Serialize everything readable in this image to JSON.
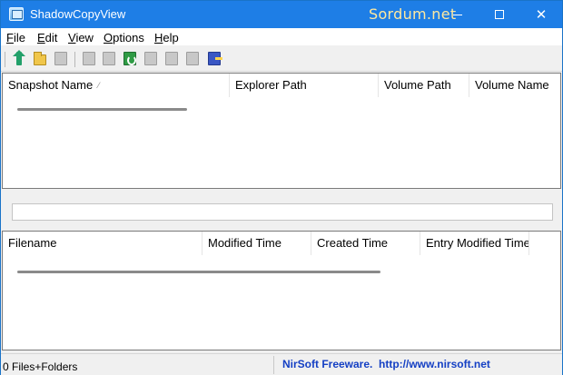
{
  "window": {
    "title": "ShadowCopyView",
    "watermark": "Sordum.net",
    "minimize_glyph": "",
    "maximize_glyph": "",
    "close_glyph": "✕"
  },
  "menu": [
    {
      "label": "File",
      "accel": "F",
      "rest": "ile"
    },
    {
      "label": "Edit",
      "accel": "E",
      "rest": "dit"
    },
    {
      "label": "View",
      "accel": "V",
      "rest": "iew"
    },
    {
      "label": "Options",
      "accel": "O",
      "rest": "ptions"
    },
    {
      "label": "Help",
      "accel": "H",
      "rest": "elp"
    }
  ],
  "toolbar": [
    {
      "icon": "up-arrow-icon",
      "enabled": true
    },
    {
      "icon": "open-folder-icon",
      "enabled": true
    },
    {
      "icon": "copy-files-icon",
      "enabled": false
    },
    {
      "icon": "properties-icon",
      "enabled": false
    },
    {
      "icon": "save-icon",
      "enabled": false
    },
    {
      "icon": "refresh-icon",
      "enabled": true
    },
    {
      "icon": "copy-icon",
      "enabled": false
    },
    {
      "icon": "html-report-icon",
      "enabled": false
    },
    {
      "icon": "find-icon",
      "enabled": false
    },
    {
      "icon": "exit-icon",
      "enabled": true
    }
  ],
  "snapshots_table": {
    "columns": [
      "Snapshot Name",
      "Explorer Path",
      "Volume Path",
      "Volume Name"
    ],
    "sort_indicator": "⁄",
    "rows": []
  },
  "search": {
    "value": ""
  },
  "files_table": {
    "columns": [
      "Filename",
      "Modified Time",
      "Created Time",
      "Entry Modified Time"
    ],
    "rows": []
  },
  "status": {
    "count": "0 Files+Folders",
    "credit": "NirSoft Freeware.  http://www.nirsoft.net"
  }
}
